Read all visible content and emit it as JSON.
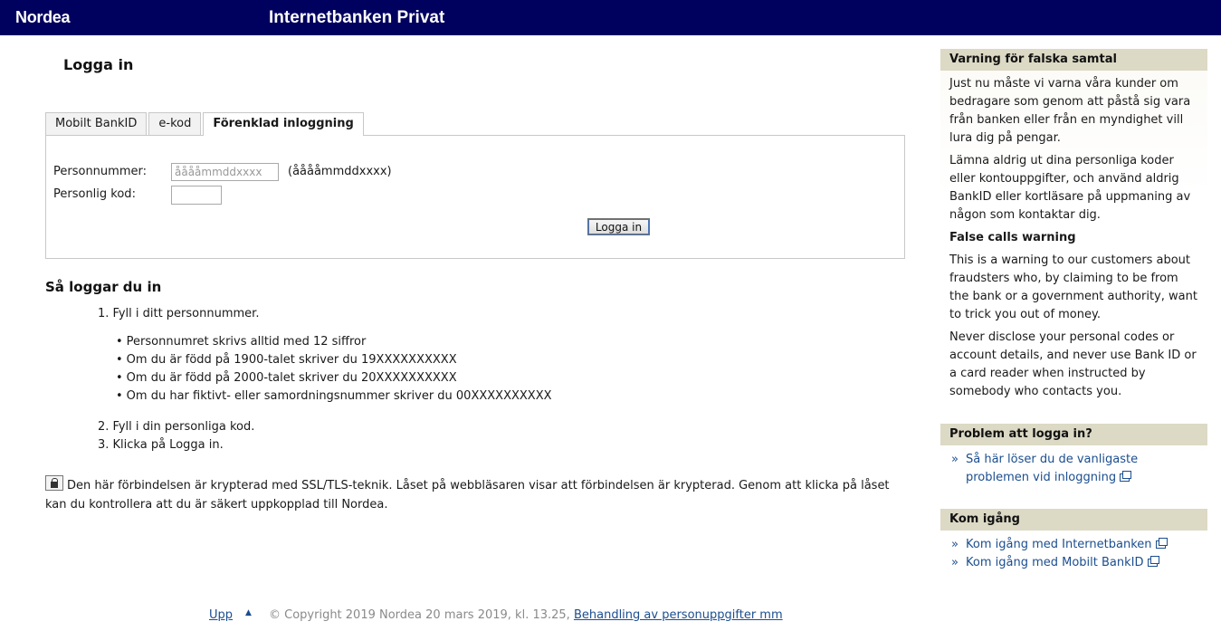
{
  "header": {
    "logo": "Nordea",
    "app_title": "Internetbanken Privat"
  },
  "main": {
    "page_title": "Logga in",
    "tabs": [
      {
        "label": "Mobilt BankID",
        "active": false
      },
      {
        "label": "e-kod",
        "active": false
      },
      {
        "label": "Förenklad inloggning",
        "active": true
      }
    ],
    "form": {
      "personnummer_label": "Personnummer:",
      "personnummer_placeholder": "ååååmmddxxxx",
      "personnummer_hint": "(ååååmmddxxxx)",
      "kod_label": "Personlig kod:",
      "kod_value": "",
      "submit_label": "Logga in"
    },
    "howto": {
      "title": "Så loggar du in",
      "step1": "1. Fyll i ditt personnummer.",
      "bullets": [
        "Personnumret skrivs alltid med 12 siffror",
        "Om du är född på 1900-talet skriver du 19XXXXXXXXXX",
        "Om du är född på 2000-talet skriver du 20XXXXXXXXXX",
        "Om du har fiktivt- eller samordningsnummer skriver du 00XXXXXXXXXX"
      ],
      "step2": "2. Fyll i din personliga kod.",
      "step3": "3. Klicka på Logga in."
    },
    "ssl_text": "Den här förbindelsen är krypterad med SSL/TLS-teknik. Låset på webbläsaren visar att förbindelsen är krypterad. Genom att klicka på låset kan du kontrollera att du är säkert uppkopplad till Nordea."
  },
  "sidebar": {
    "warning": {
      "title": "Varning för falska samtal",
      "p1": "Just nu måste vi varna våra kunder om bedragare som genom att påstå sig vara från banken eller från en myndighet vill lura dig på pengar.",
      "p2": "Lämna aldrig ut dina personliga koder eller kontouppgifter, och använd aldrig BankID eller kortläsare på uppmaning av någon som kontaktar dig.",
      "p3": "False calls warning",
      "p4": "This is a warning to our customers about fraudsters who, by claiming to be from the bank or a government authority, want to trick you out of money.",
      "p5": "Never disclose your personal codes or account details, and never use Bank ID or a card reader when instructed by somebody who contacts you."
    },
    "problem": {
      "title": "Problem att logga in?",
      "links": [
        "Så här löser du de vanligaste problemen vid inloggning"
      ]
    },
    "start": {
      "title": "Kom igång",
      "links": [
        "Kom igång med Internetbanken",
        "Kom igång med Mobilt BankID"
      ]
    }
  },
  "footer": {
    "upp": "Upp",
    "copyright": "© Copyright 2019 Nordea 20 mars 2019, kl. 13.25,",
    "privacy_link": "Behandling av personuppgifter mm"
  }
}
